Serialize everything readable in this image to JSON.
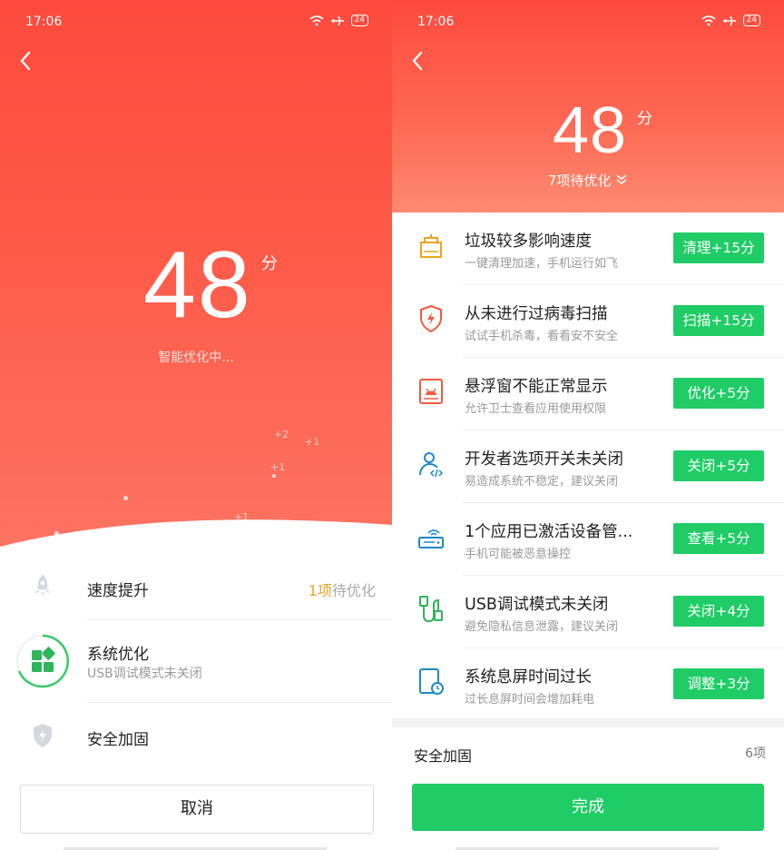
{
  "left": {
    "status": {
      "time": "17:06",
      "battery": "24"
    },
    "score": "48",
    "unit": "分",
    "optimizing_text": "智能优化中...",
    "floating": [
      "+2",
      "+1",
      "+1",
      "+1"
    ],
    "rows": [
      {
        "title": "速度提升",
        "right_num": "1项",
        "right_text": "待优化"
      },
      {
        "title": "系统优化",
        "subtitle": "USB调试模式未关闭"
      },
      {
        "title": "安全加固"
      }
    ],
    "cancel_label": "取消"
  },
  "right": {
    "status": {
      "time": "17:06",
      "battery": "24"
    },
    "score": "48",
    "unit": "分",
    "pending_text": "7项待优化",
    "items": [
      {
        "icon": "trash-icon",
        "title": "垃圾较多影响速度",
        "subtitle": "一键清理加速，手机运行如飞",
        "button": "清理+15分"
      },
      {
        "icon": "shield-bolt-icon",
        "title": "从未进行过病毒扫描",
        "subtitle": "试试手机杀毒，看看安不安全",
        "button": "扫描+15分"
      },
      {
        "icon": "floating-window-icon",
        "title": "悬浮窗不能正常显示",
        "subtitle": "允许卫士查看应用使用权限",
        "button": "优化+5分"
      },
      {
        "icon": "developer-icon",
        "title": "开发者选项开关未关闭",
        "subtitle": "易造成系统不稳定，建议关闭",
        "button": "关闭+5分"
      },
      {
        "icon": "device-manager-icon",
        "title": "1个应用已激活设备管...",
        "subtitle": "手机可能被恶意操控",
        "button": "查看+5分"
      },
      {
        "icon": "usb-icon",
        "title": "USB调试模式未关闭",
        "subtitle": "避免隐私信息泄露，建议关闭",
        "button": "关闭+4分"
      },
      {
        "icon": "screen-timeout-icon",
        "title": "系统息屏时间过长",
        "subtitle": "过长息屏时间会增加耗电",
        "button": "调整+3分"
      }
    ],
    "security": {
      "title": "安全加固",
      "count": "6项"
    },
    "done_label": "完成"
  },
  "colors": {
    "accent_red": "#fe4a3e",
    "green": "#1fcc66",
    "amber": "#e6a421",
    "blue": "#1e88c7"
  }
}
